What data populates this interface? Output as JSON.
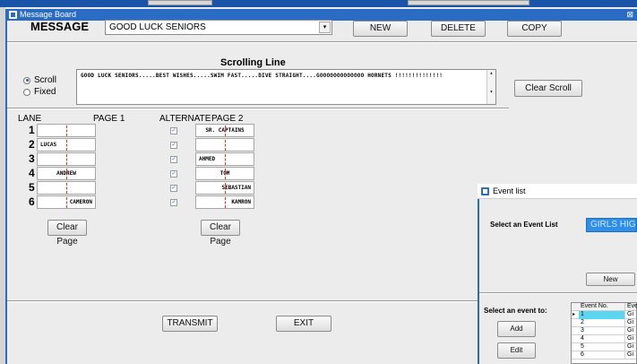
{
  "window": {
    "title": "Message Board"
  },
  "message": {
    "label": "MESSAGE",
    "selected": "GOOD LUCK SENIORS",
    "buttons": {
      "new": "NEW",
      "delete": "DELETE",
      "copy": "COPY"
    }
  },
  "scrolling": {
    "heading": "Scrolling Line",
    "mode_scroll": "Scroll",
    "mode_fixed": "Fixed",
    "selected_mode": "Scroll",
    "text": "GOOD LUCK SENIORS.....BEST WISHES.....SWIM FAST.....DIVE STRAIGHT....GOOOOOOOOOOOOO HORNETS !!!!!!!!!!!!!!",
    "clear_button": "Clear Scroll"
  },
  "lanes": {
    "header_lane": "LANE",
    "header_page1": "PAGE 1",
    "header_alternate": "ALTERNATE",
    "header_page2": "PAGE 2",
    "rows": [
      {
        "num": "1",
        "page1": "",
        "alternate": true,
        "page2": "SR. CAPTAINS"
      },
      {
        "num": "2",
        "page1": "LUCAS",
        "alternate": true,
        "page2": ""
      },
      {
        "num": "3",
        "page1": "",
        "alternate": true,
        "page2": "AHMED"
      },
      {
        "num": "4",
        "page1": "ANDREW",
        "alternate": true,
        "page2": "TOM"
      },
      {
        "num": "5",
        "page1": "",
        "alternate": true,
        "page2": "SEBASTIAN"
      },
      {
        "num": "6",
        "page1": "CAMERON",
        "alternate": true,
        "page2": "KAMRON"
      }
    ],
    "clear_page1": "Clear Page",
    "clear_page2": "Clear Page"
  },
  "footer": {
    "transmit": "TRANSMIT",
    "exit": "EXIT"
  },
  "event_list": {
    "title": "Event list",
    "select_label": "Select an Event List",
    "selected_list": "GIRLS HIGH SC",
    "new_button": "New",
    "select_event_label": "Select an event to:",
    "add_button": "Add",
    "edit_button": "Edit",
    "columns": [
      "Event No.",
      "Eve"
    ],
    "rows": [
      {
        "no": "1",
        "ev": "Gi"
      },
      {
        "no": "2",
        "ev": "Gi"
      },
      {
        "no": "3",
        "ev": "Gi"
      },
      {
        "no": "4",
        "ev": "Gi"
      },
      {
        "no": "5",
        "ev": "Gi"
      },
      {
        "no": "6",
        "ev": "Gi"
      }
    ],
    "selected_row": 0
  },
  "colors": {
    "title_bar": "#2a6cc4",
    "selected_list": "#2f8fe8",
    "selected_row": "#5cd6f0",
    "guide_line": "#d33333"
  }
}
